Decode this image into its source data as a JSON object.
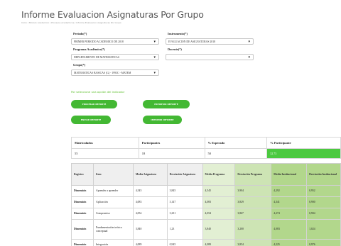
{
  "page_title": "Informe Evaluacion Asignaturas Por Grupo",
  "breadcrumb": "Inicio / Modulo Academico / Procesos Academicos / Informe Evaluacion Asignaturas Por Grupo",
  "form": {
    "periodo_label": "Periodo(*)",
    "periodo_value": "PRIMER PERIODO ACADEMICO DE 2018",
    "instrumento_label": "Instrumento(*)",
    "instrumento_value": "EVALUACION DE ASIGNATURAS 2018",
    "programa_label": "Programa Académico(*)",
    "programa_value": "DEPARTAMENTO DE MATEMATICAS",
    "docente_label": "Docente(*)",
    "docente_value": "",
    "grupo_label": "Grupo(*)",
    "grupo_value": "MATEMATICAS BASICAS (G) - 1993C - MATEM"
  },
  "note": "Por seleccione una opción del indicador",
  "buttons": {
    "b1": "PROCESAR REPORTE",
    "b2": "EXPORTAR REPORTE",
    "b3": "ENVIAR REPORTE",
    "b4": "IMPRIMIR INFORME"
  },
  "summary": {
    "headers": [
      "Matriculados",
      "Participantes",
      "% Esperado",
      "% Participante"
    ],
    "values": [
      "55",
      "18",
      "50",
      "32.73"
    ],
    "participation_pct": 32.73
  },
  "detail": {
    "headers": [
      "Registro",
      "Item",
      "Media Asignatura",
      "Desviación Asignatura",
      "Media Programa",
      "Desviación Programa",
      "Media Institucional",
      "Desviación Institucional"
    ],
    "rows": [
      [
        "Dimensión",
        "Aprender a aprender",
        "4,545",
        "3,845",
        "4,545",
        "3,904",
        "4,292",
        "0,952"
      ],
      [
        "Dimensión",
        "Aplicación",
        "4,083",
        "3,147",
        "4,083",
        "3,829",
        "4,341",
        "0,900"
      ],
      [
        "Dimensión",
        "Compromiso",
        "4,054",
        "3,231",
        "4,054",
        "3,867",
        "4,274",
        "0,904"
      ],
      [
        "Dimensión",
        "Fundamentación teórica conceptual",
        "3,840",
        "1,23",
        "3,840",
        "3,200",
        "4,083",
        "1,024"
      ],
      [
        "Dimensión",
        "Integración",
        "4,089",
        "0,945",
        "4,089",
        "3,854",
        "4,225",
        "0,976"
      ]
    ]
  },
  "colors": {
    "accent_green": "#43b833",
    "bar_green": "#4cc940",
    "note_green": "#5fbf2f"
  },
  "icons": {
    "dropdown": "chevron-down-icon"
  }
}
